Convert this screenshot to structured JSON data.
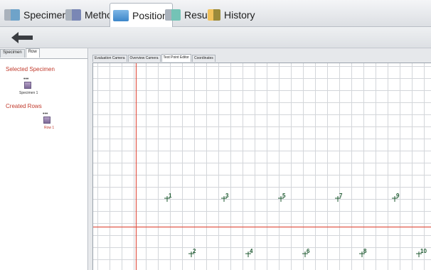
{
  "main_tabs": [
    {
      "label": "Specimen",
      "icon": "specimen-icon"
    },
    {
      "label": "Method",
      "icon": "method-icon"
    },
    {
      "label": "Position",
      "icon": "position-icon",
      "active": true
    },
    {
      "label": "Result",
      "icon": "result-icon"
    },
    {
      "label": "History",
      "icon": "history-icon"
    }
  ],
  "toolbar": {
    "back_icon": "back-arrow-icon"
  },
  "left_panel": {
    "tabs": [
      "Specimen",
      "Row"
    ],
    "active_tab": "Row",
    "selected_specimen_title": "Selected Specimen",
    "specimen_item": {
      "dots": "•••",
      "label": "Specimen 1"
    },
    "created_rows_title": "Created Rows",
    "row_item": {
      "dots": "•••",
      "label": "Row 1"
    }
  },
  "right_panel": {
    "tabs": [
      "Evaluation Camera",
      "Overview Camera",
      "Test Point Editor",
      "Coordinates"
    ],
    "active_tab": "Test Point Editor"
  },
  "test_points": [
    {
      "label": "1",
      "row": 1,
      "col": 1
    },
    {
      "label": "3",
      "row": 1,
      "col": 2
    },
    {
      "label": "5",
      "row": 1,
      "col": 3
    },
    {
      "label": "7",
      "row": 1,
      "col": 4
    },
    {
      "label": "9",
      "row": 1,
      "col": 5
    },
    {
      "label": "2",
      "row": 2,
      "col": 1
    },
    {
      "label": "4",
      "row": 2,
      "col": 2
    },
    {
      "label": "6",
      "row": 2,
      "col": 3
    },
    {
      "label": "8",
      "row": 2,
      "col": 4
    },
    {
      "label": "10",
      "row": 2,
      "col": 5
    }
  ],
  "colors": {
    "axis_line": "#e0584a",
    "grid_line": "#d3d6da",
    "point_color": "#1f5a32",
    "section_title": "#c0392b"
  }
}
